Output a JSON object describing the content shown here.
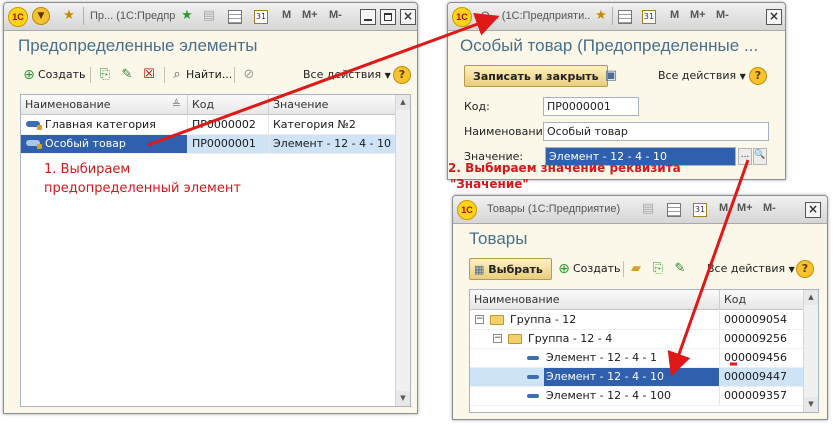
{
  "win1": {
    "title": "Пр... (1С:Предпр...",
    "form_title": "Предопределенные элементы",
    "toolbar": {
      "create_label": "Создать",
      "find_label": "Найти...",
      "all_actions_label": "Все действия",
      "help_label": "?"
    },
    "columns": [
      "Наименование",
      "Код",
      "Значение"
    ],
    "rows": [
      {
        "name": "Главная категория",
        "code": "ПР0000002",
        "value": "Категория №2",
        "selected": false
      },
      {
        "name": "Особый товар",
        "code": "ПР0000001",
        "value": "Элемент - 12 - 4 - 10",
        "selected": true
      }
    ]
  },
  "win2": {
    "title": "О... (1С:Предприяти...",
    "form_title": "Особый товар (Предопределенные ...",
    "toolbar": {
      "save_close_label": "Записать и закрыть",
      "all_actions_label": "Все действия",
      "help_label": "?"
    },
    "fields": {
      "code_label": "Код:",
      "code_value": "ПР0000001",
      "name_label": "Наименование:",
      "name_value": "Особый товар",
      "value_label": "Значение:",
      "value_value": "Элемент - 12 - 4 - 10",
      "choose_button": "...",
      "search_button": "🔍"
    }
  },
  "win3": {
    "title": "Товары (1С:Предприятие)",
    "form_title": "Товары",
    "toolbar": {
      "choose_label": "Выбрать",
      "create_label": "Создать",
      "all_actions_label": "Все действия",
      "help_label": "?"
    },
    "columns": [
      "Наименование",
      "Код"
    ],
    "rows": [
      {
        "name": "Группа - 12",
        "code": "000009054"
      },
      {
        "name": "Группа - 12 - 4",
        "code": "000009256"
      },
      {
        "name": "Элемент - 12 - 4 - 1",
        "code": "000009456"
      },
      {
        "name": "Элемент - 12 - 4 - 10",
        "code": "000009447"
      },
      {
        "name": "Элемент - 12 - 4 - 100",
        "code": "000009357"
      }
    ]
  },
  "annotations": {
    "step1_line1": "1. Выбираем",
    "step1_line2": "предопределенный элемент",
    "step2_line1": "2. Выбираем значение реквизита",
    "step2_line2": "\"Значение\""
  },
  "common": {
    "m_label": "M",
    "mplus_label": "M+",
    "mminus_label": "M-",
    "close_label": "×",
    "calendar_label": "31",
    "logo_label": "1C"
  },
  "colors": {
    "annotation": "#d21a1a",
    "selection": "#2f5fad",
    "title": "#4a6f8a"
  }
}
